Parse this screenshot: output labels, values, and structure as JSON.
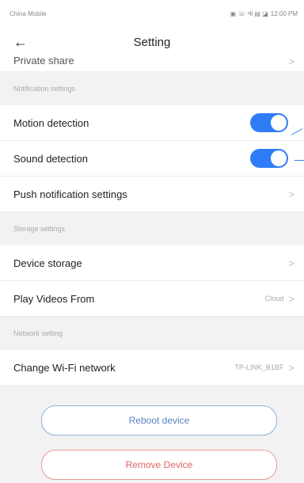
{
  "status_bar": {
    "carrier": "China Mobile",
    "indicators": "▣ ☏ ᵃll ▤ ◪",
    "time": "12:00 PM"
  },
  "header": {
    "title": "Setting",
    "back_icon": "arrow-left-icon"
  },
  "partial_row": {
    "label": "Private share"
  },
  "sections": {
    "notification": "Notification settings",
    "storage": "Storage settings",
    "network": "Network setting"
  },
  "rows": {
    "motion": {
      "label": "Motion detection",
      "enabled": true
    },
    "sound": {
      "label": "Sound detection",
      "enabled": true
    },
    "push": {
      "label": "Push notification settings"
    },
    "storage": {
      "label": "Device storage"
    },
    "play": {
      "label": "Play Videos From",
      "value": "Cloud"
    },
    "wifi": {
      "label": "Change Wi-Fi network",
      "value": "TP-LINK_B1BF"
    }
  },
  "buttons": {
    "reboot": "Reboot device",
    "remove": "Remove Device"
  },
  "colors": {
    "accent": "#2f7df6",
    "reboot": "#5a84c0",
    "remove": "#e06565",
    "section_bg": "#f2f2f2"
  }
}
